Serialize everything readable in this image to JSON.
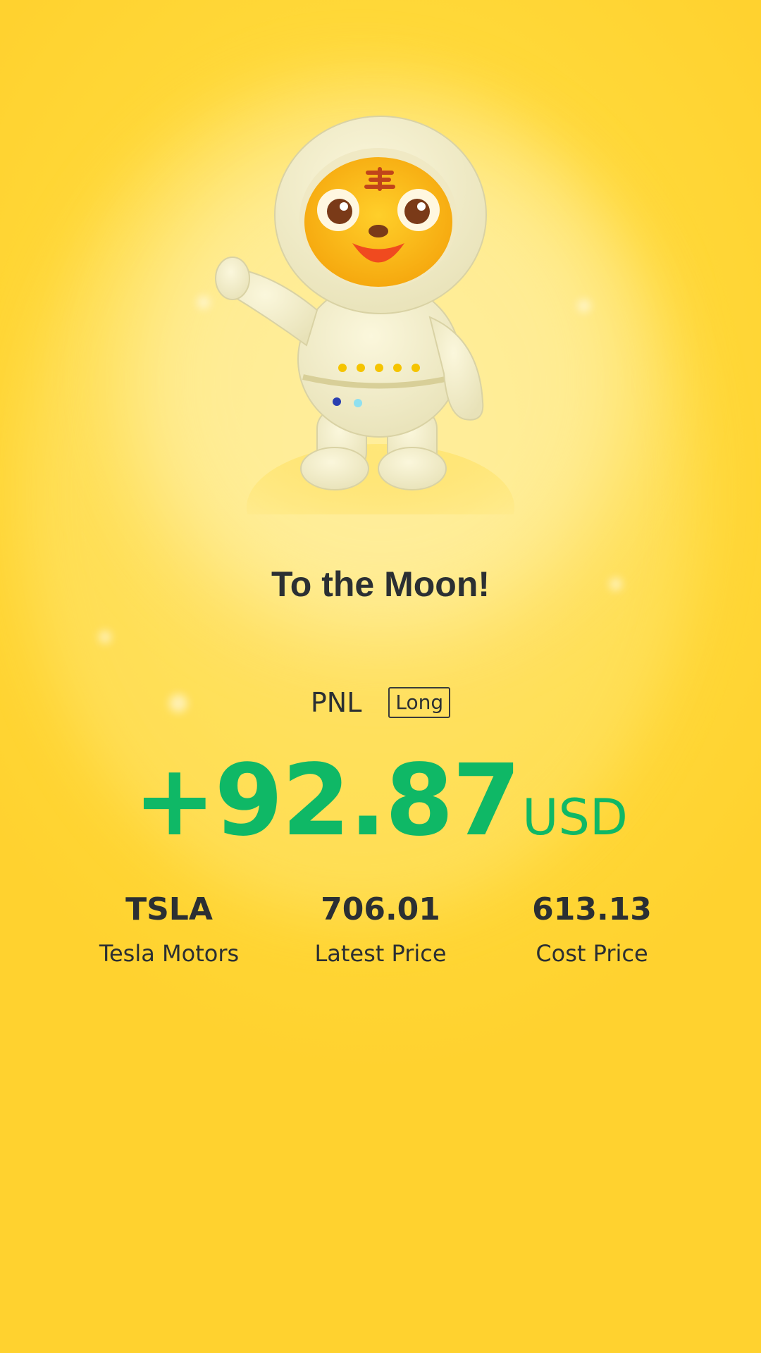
{
  "header": {
    "title": "To the Moon!"
  },
  "pnl": {
    "label": "PNL",
    "direction_badge": "Long",
    "amount": "+92.87",
    "currency": "USD",
    "color": "#0fb866"
  },
  "stats": [
    {
      "value": "TSLA",
      "label": "Tesla Motors"
    },
    {
      "value": "706.01",
      "label": "Latest Price"
    },
    {
      "value": "613.13",
      "label": "Cost Price"
    }
  ],
  "theme": {
    "background": "#ffd93a",
    "text": "#2b2f33"
  },
  "mascot": {
    "icon": "tiger-astronaut-mascot-icon"
  }
}
